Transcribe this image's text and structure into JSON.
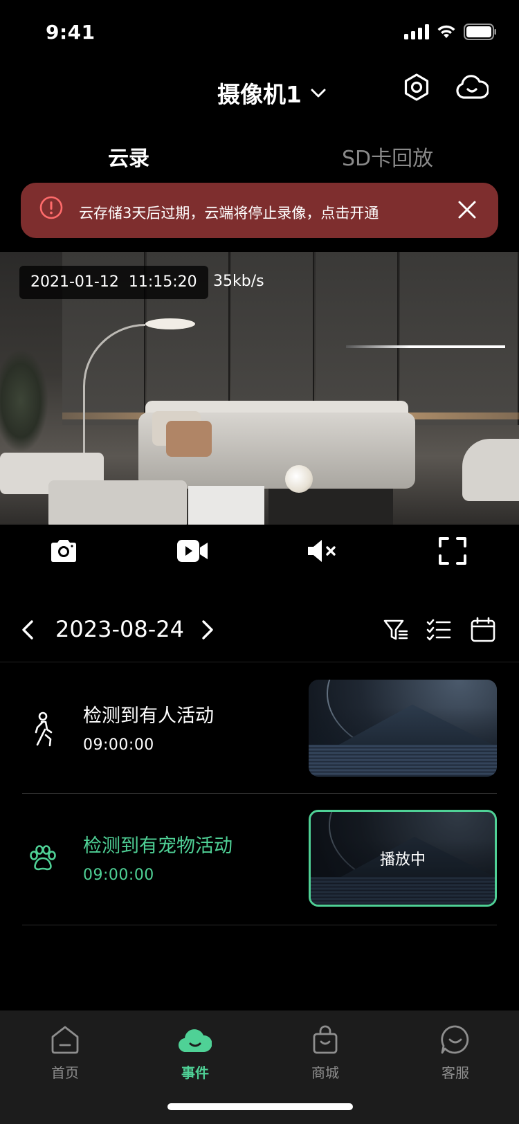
{
  "status_bar": {
    "time": "9:41"
  },
  "header": {
    "camera_name": "摄像机1"
  },
  "tabs": [
    {
      "label": "云录",
      "active": true
    },
    {
      "label": "SD卡回放",
      "active": false
    }
  ],
  "alert": {
    "message": "云存储3天后过期，云端将停止录像，点击开通"
  },
  "video": {
    "timestamp": "2021-01-12  11:15:20",
    "bitrate": "35kb/s"
  },
  "date_bar": {
    "date": "2023-08-24"
  },
  "events": [
    {
      "title": "检测到有人活动",
      "time": "09:00:00",
      "icon": "person-walking-icon",
      "highlighted": false
    },
    {
      "title": "检测到有宠物活动",
      "time": "09:00:00",
      "icon": "paw-icon",
      "highlighted": true,
      "status": "播放中"
    }
  ],
  "bottom_nav": [
    {
      "label": "首页",
      "icon": "home-icon",
      "active": false
    },
    {
      "label": "事件",
      "icon": "cloud-icon",
      "active": true
    },
    {
      "label": "商城",
      "icon": "shopping-bag-icon",
      "active": false
    },
    {
      "label": "客服",
      "icon": "chat-smile-icon",
      "active": false
    }
  ],
  "colors": {
    "accent": "#4fd196",
    "alert_bg": "#7e2e2e",
    "alert_icon": "#ff6b6b",
    "inactive_text": "#8e8e8e"
  }
}
